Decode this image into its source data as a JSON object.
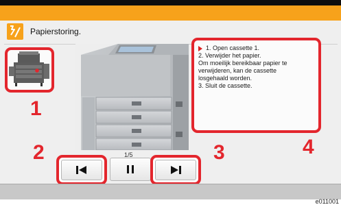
{
  "header": {
    "title": "Papierstoring.",
    "icon": "paper-jam-icon"
  },
  "instructions": {
    "lines": [
      "1. Open cassette 1.",
      "2. Verwijder het papier.",
      "Om moeilijk bereikbaar papier te",
      "verwijderen, kan de cassette",
      "losgehaald worden.",
      "3. Sluit de cassette."
    ]
  },
  "navigation": {
    "page_indicator": "1/5",
    "previous_icon": "skip-back-icon",
    "pause_icon": "pause-icon",
    "next_icon": "skip-forward-icon"
  },
  "callouts": {
    "c1": "1",
    "c2": "2",
    "c3": "3",
    "c4": "4"
  },
  "footer": {
    "code": "e011001"
  },
  "colors": {
    "accent": "#f7a21b",
    "highlight": "#e3262d"
  }
}
